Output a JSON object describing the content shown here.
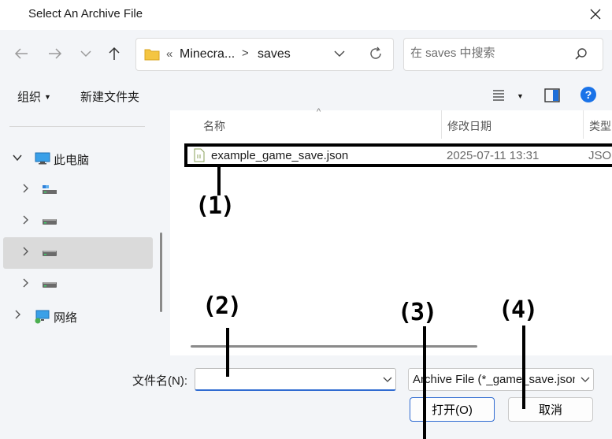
{
  "window": {
    "title": "Select An Archive File"
  },
  "nav": {
    "breadcrumb_overflow": "«",
    "breadcrumb": [
      "Minecra...",
      "saves"
    ],
    "breadcrumb_sep": ">",
    "search_placeholder": "在 saves 中搜索"
  },
  "toolbar": {
    "organize_label": "组织",
    "new_folder_label": "新建文件夹"
  },
  "sidebar": {
    "items": [
      {
        "label": "此电脑",
        "icon": "computer-icon",
        "expanded": true
      },
      {
        "label": "",
        "icon": "drive-icon"
      },
      {
        "label": "",
        "icon": "drive-icon"
      },
      {
        "label": "",
        "icon": "drive-icon",
        "selected": true
      },
      {
        "label": "",
        "icon": "drive-icon"
      },
      {
        "label": "网络",
        "icon": "network-icon"
      }
    ]
  },
  "files": {
    "columns": [
      "名称",
      "修改日期",
      "类型"
    ],
    "rows": [
      {
        "name": "example_game_save.json",
        "modified": "2025-07-11 13:31",
        "type": "JSON"
      }
    ]
  },
  "footer": {
    "filename_label": "文件名(N):",
    "filename_value": "",
    "filter_value": "Archive File (*_game_save.json)",
    "open_label": "打开(O)",
    "cancel_label": "取消"
  },
  "annotations": [
    "(1)",
    "(2)",
    "(3)",
    "(4)"
  ]
}
